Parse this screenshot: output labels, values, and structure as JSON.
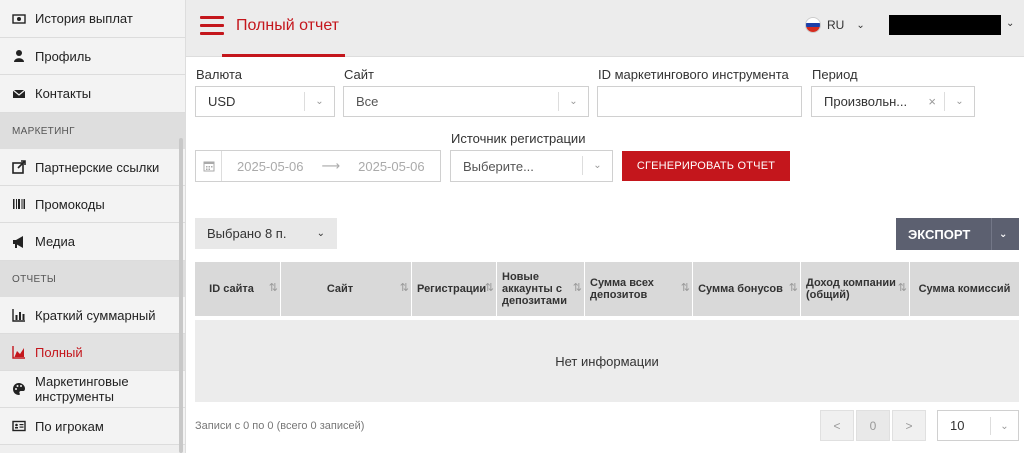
{
  "sidebar": {
    "items": [
      {
        "label": "История выплат",
        "icon": "money-icon"
      },
      {
        "label": "Профиль",
        "icon": "user-icon"
      },
      {
        "label": "Контакты",
        "icon": "envelope-icon"
      },
      {
        "label": "Партнерские ссылки",
        "icon": "external-link-icon"
      },
      {
        "label": "Промокоды",
        "icon": "barcode-icon"
      },
      {
        "label": "Медиа",
        "icon": "megaphone-icon"
      },
      {
        "label": "Краткий суммарный",
        "icon": "bar-chart-icon"
      },
      {
        "label": "Полный",
        "icon": "area-chart-icon"
      },
      {
        "label": "Маркетинговые инструменты",
        "icon": "palette-icon"
      },
      {
        "label": "По игрокам",
        "icon": "id-card-icon"
      }
    ],
    "sections": {
      "marketing": "МАРКЕТИНГ",
      "reports": "ОТЧЕТЫ"
    }
  },
  "header": {
    "title": "Полный отчет",
    "language": "RU"
  },
  "filters": {
    "currency_label": "Валюта",
    "currency_value": "USD",
    "site_label": "Сайт",
    "site_value": "Все",
    "marketing_id_label": "ID маркетингового инструмента",
    "marketing_id_value": "",
    "period_label": "Период",
    "period_value": "Произвольн...",
    "date_from": "2025-05-06",
    "date_to": "2025-05-06",
    "reg_source_label": "Источник регистрации",
    "reg_source_placeholder": "Выберите...",
    "generate_button": "СГЕНЕРИРОВАТЬ ОТЧЕТ"
  },
  "table": {
    "selected_label": "Выбрано 8 п.",
    "export_label": "ЭКСПОРТ",
    "columns": [
      "ID сайта",
      "Сайт",
      "Регистрации",
      "Новые аккаунты с депозитами",
      "Сумма всех депозитов",
      "Сумма бонусов",
      "Доход компании (общий)",
      "Сумма комиссий"
    ],
    "empty_text": "Нет информации",
    "records_text": "Записи с 0 по 0 (всего 0 записей)",
    "pager": {
      "prev": "<",
      "current": "0",
      "next": ">"
    },
    "page_size": "10"
  },
  "colors": {
    "accent": "#c4161c",
    "export_bg": "#5c6070",
    "header_bg": "#ececec"
  }
}
